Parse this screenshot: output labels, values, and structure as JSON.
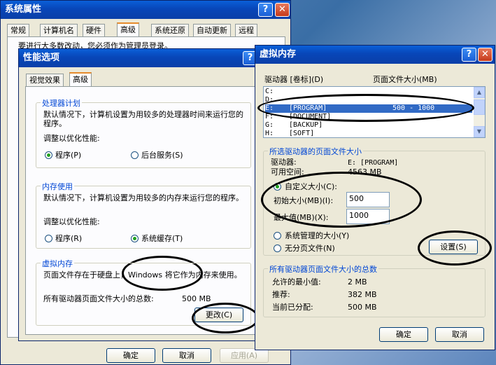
{
  "sysprops": {
    "title": "系统属性",
    "tabs": [
      "常规",
      "计算机名",
      "硬件",
      "高级",
      "系统还原",
      "自动更新",
      "远程"
    ],
    "partial_text": "要进行大多数改动，您必须作为管理员登录。",
    "buttons": {
      "ok": "确定",
      "cancel": "取消",
      "apply": "应用(A)"
    }
  },
  "perf": {
    "title": "性能选项",
    "tabs": [
      "视觉效果",
      "高级"
    ],
    "cpu": {
      "label": "处理器计划",
      "desc": "默认情况下，计算机设置为用较多的处理器时间来运行您的程序。",
      "adjust": "调整以优化性能:",
      "opt1": "程序(P)",
      "opt2": "后台服务(S)"
    },
    "mem": {
      "label": "内存使用",
      "desc": "默认情况下，计算机设置为用较多的内存来运行您的程序。",
      "adjust": "调整以优化性能:",
      "opt1": "程序(R)",
      "opt2": "系统缓存(T)"
    },
    "vm": {
      "label": "虚拟内存",
      "desc": "页面文件存在于硬盘上，Windows 将它作为内存来使用。",
      "total_label": "所有驱动器页面文件大小的总数:",
      "total_value": "500 MB",
      "change_btn": "更改(C)"
    }
  },
  "vmdlg": {
    "title": "虚拟内存",
    "col_drive": "驱动器 [卷标](D)",
    "col_size": "页面文件大小(MB)",
    "drives": [
      {
        "letter": "C:",
        "label": "",
        "size": ""
      },
      {
        "letter": "D:",
        "label": "",
        "size": ""
      },
      {
        "letter": "E:",
        "label": "[PROGRAM]",
        "size": "500 - 1000"
      },
      {
        "letter": "F:",
        "label": "[DOCUMENT]",
        "size": ""
      },
      {
        "letter": "G:",
        "label": "[BACKUP]",
        "size": ""
      },
      {
        "letter": "H:",
        "label": "[SOFT]",
        "size": ""
      }
    ],
    "selected": {
      "group_label": "所选驱动器的页面文件大小",
      "drive_label": "驱动器:",
      "drive_value": "E:  [PROGRAM]",
      "space_label": "可用空间:",
      "space_value": "4563 MB",
      "custom": "自定义大小(C):",
      "initial_label": "初始大小(MB)(I):",
      "initial_value": "500",
      "max_label": "最大值(MB)(X):",
      "max_value": "1000",
      "system_managed": "系统管理的大小(Y)",
      "no_paging": "无分页文件(N)",
      "set_btn": "设置(S)"
    },
    "totals": {
      "group_label": "所有驱动器页面文件大小的总数",
      "min_label": "允许的最小值:",
      "min_value": "2 MB",
      "rec_label": "推荐:",
      "rec_value": "382 MB",
      "cur_label": "当前已分配:",
      "cur_value": "500 MB"
    },
    "buttons": {
      "ok": "确定",
      "cancel": "取消"
    }
  }
}
